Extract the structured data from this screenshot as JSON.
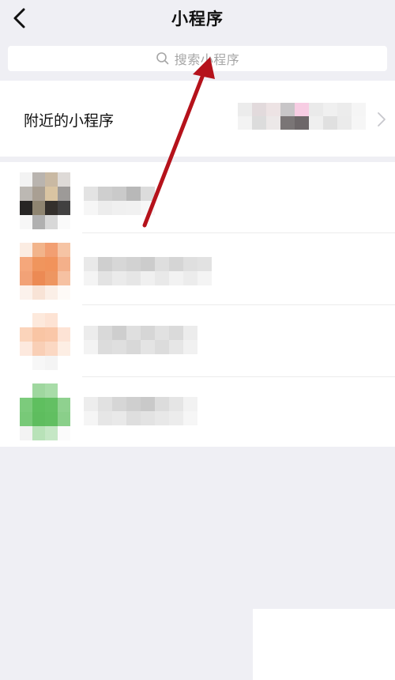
{
  "header": {
    "title": "小程序",
    "back_icon": "chevron-left-icon"
  },
  "search": {
    "placeholder": "搜索小程序",
    "icon": "search-icon"
  },
  "nearby": {
    "label": "附近的小程序",
    "chevron_icon": "chevron-right-icon"
  },
  "list": {
    "items": [
      {
        "name": "",
        "icon_state": "pixelated"
      },
      {
        "name": "",
        "icon_state": "pixelated"
      },
      {
        "name": "",
        "icon_state": "pixelated"
      },
      {
        "name": "",
        "icon_state": "pixelated"
      }
    ]
  },
  "annotation": {
    "arrow_color": "#b5121b"
  }
}
